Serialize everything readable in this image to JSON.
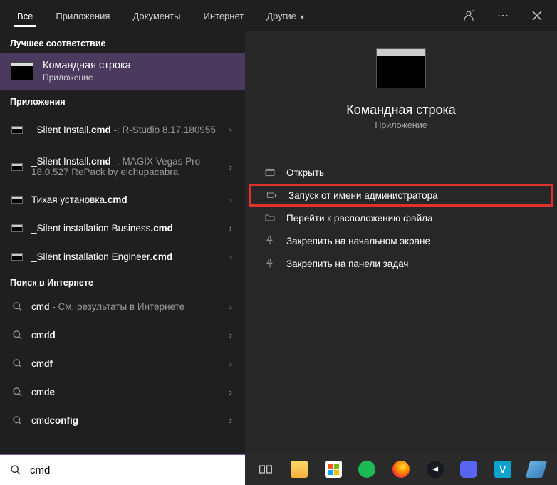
{
  "tabs": {
    "all": "Все",
    "apps": "Приложения",
    "docs": "Документы",
    "web": "Интернет",
    "more": "Другие"
  },
  "sections": {
    "best_match": "Лучшее соответствие",
    "apps": "Приложения",
    "web_search": "Поиск в Интернете"
  },
  "best_match": {
    "title": "Командная строка",
    "subtitle": "Приложение"
  },
  "apps": [
    {
      "name": "_Silent Install",
      "ext": ".cmd",
      "suffix": " -: R-Studio 8.17.180955"
    },
    {
      "name": "_Silent Install",
      "ext": ".cmd",
      "suffix": " -: MAGIX Vegas Pro 18.0.527 RePack by elchupacabra"
    },
    {
      "name": "Тихая установка",
      "ext": ".cmd",
      "suffix": ""
    },
    {
      "name": "_Silent installation Business",
      "ext": ".cmd",
      "suffix": ""
    },
    {
      "name": "_Silent installation Engineer",
      "ext": ".cmd",
      "suffix": ""
    }
  ],
  "web": [
    {
      "q": "cmd",
      "bold": "",
      "suffix": " - См. результаты в Интернете"
    },
    {
      "q": "cmd",
      "bold": "d",
      "suffix": ""
    },
    {
      "q": "cmd",
      "bold": "f",
      "suffix": ""
    },
    {
      "q": "cmd",
      "bold": "e",
      "suffix": ""
    },
    {
      "q": "cmd",
      "bold": "config",
      "suffix": ""
    }
  ],
  "detail": {
    "title": "Командная строка",
    "subtitle": "Приложение"
  },
  "actions": {
    "open": "Открыть",
    "run_admin": "Запуск от имени администратора",
    "open_location": "Перейти к расположению файла",
    "pin_start": "Закрепить на начальном экране",
    "pin_taskbar": "Закрепить на панели задач"
  },
  "search": {
    "value": "cmd"
  }
}
